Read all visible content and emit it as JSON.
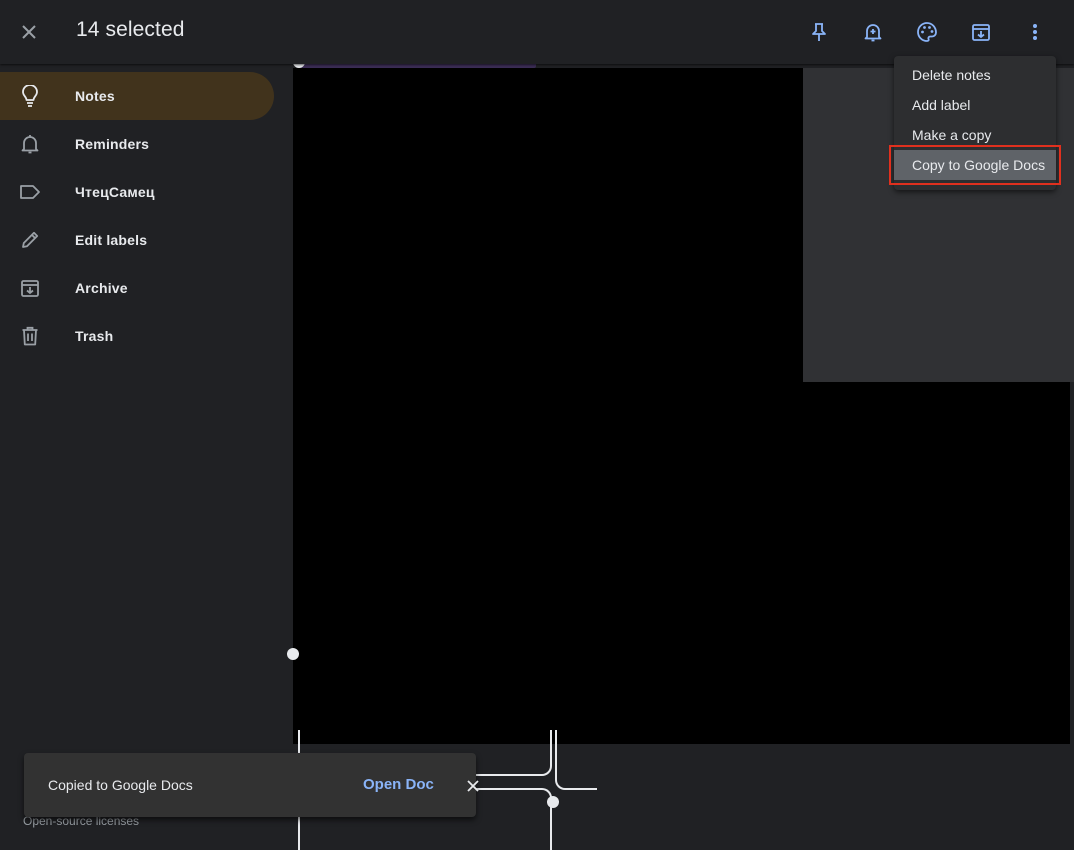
{
  "header": {
    "selected_count_text": "14 selected"
  },
  "toolbar": {
    "icons": [
      "pin-icon",
      "reminder-add-icon",
      "palette-icon",
      "archive-icon",
      "more-vert-icon"
    ],
    "accent_color": "#8ab4f8"
  },
  "sidebar": {
    "items": [
      {
        "label": "Notes",
        "icon": "lightbulb-icon",
        "active": true
      },
      {
        "label": "Reminders",
        "icon": "bell-icon",
        "active": false
      },
      {
        "label": "ЧтецСамец",
        "icon": "label-icon",
        "active": false
      },
      {
        "label": "Edit labels",
        "icon": "pencil-icon",
        "active": false
      },
      {
        "label": "Archive",
        "icon": "archive-icon",
        "active": false
      },
      {
        "label": "Trash",
        "icon": "trash-icon",
        "active": false
      }
    ],
    "active_color": "#41331c"
  },
  "more_menu": {
    "items": [
      {
        "label": "Delete notes"
      },
      {
        "label": "Add label"
      },
      {
        "label": "Make a copy"
      },
      {
        "label": "Copy to Google Docs",
        "highlighted": true
      }
    ]
  },
  "toast": {
    "message": "Copied to Google Docs",
    "action_label": "Open Doc"
  },
  "footer": {
    "licenses_link": "Open-source licenses"
  }
}
